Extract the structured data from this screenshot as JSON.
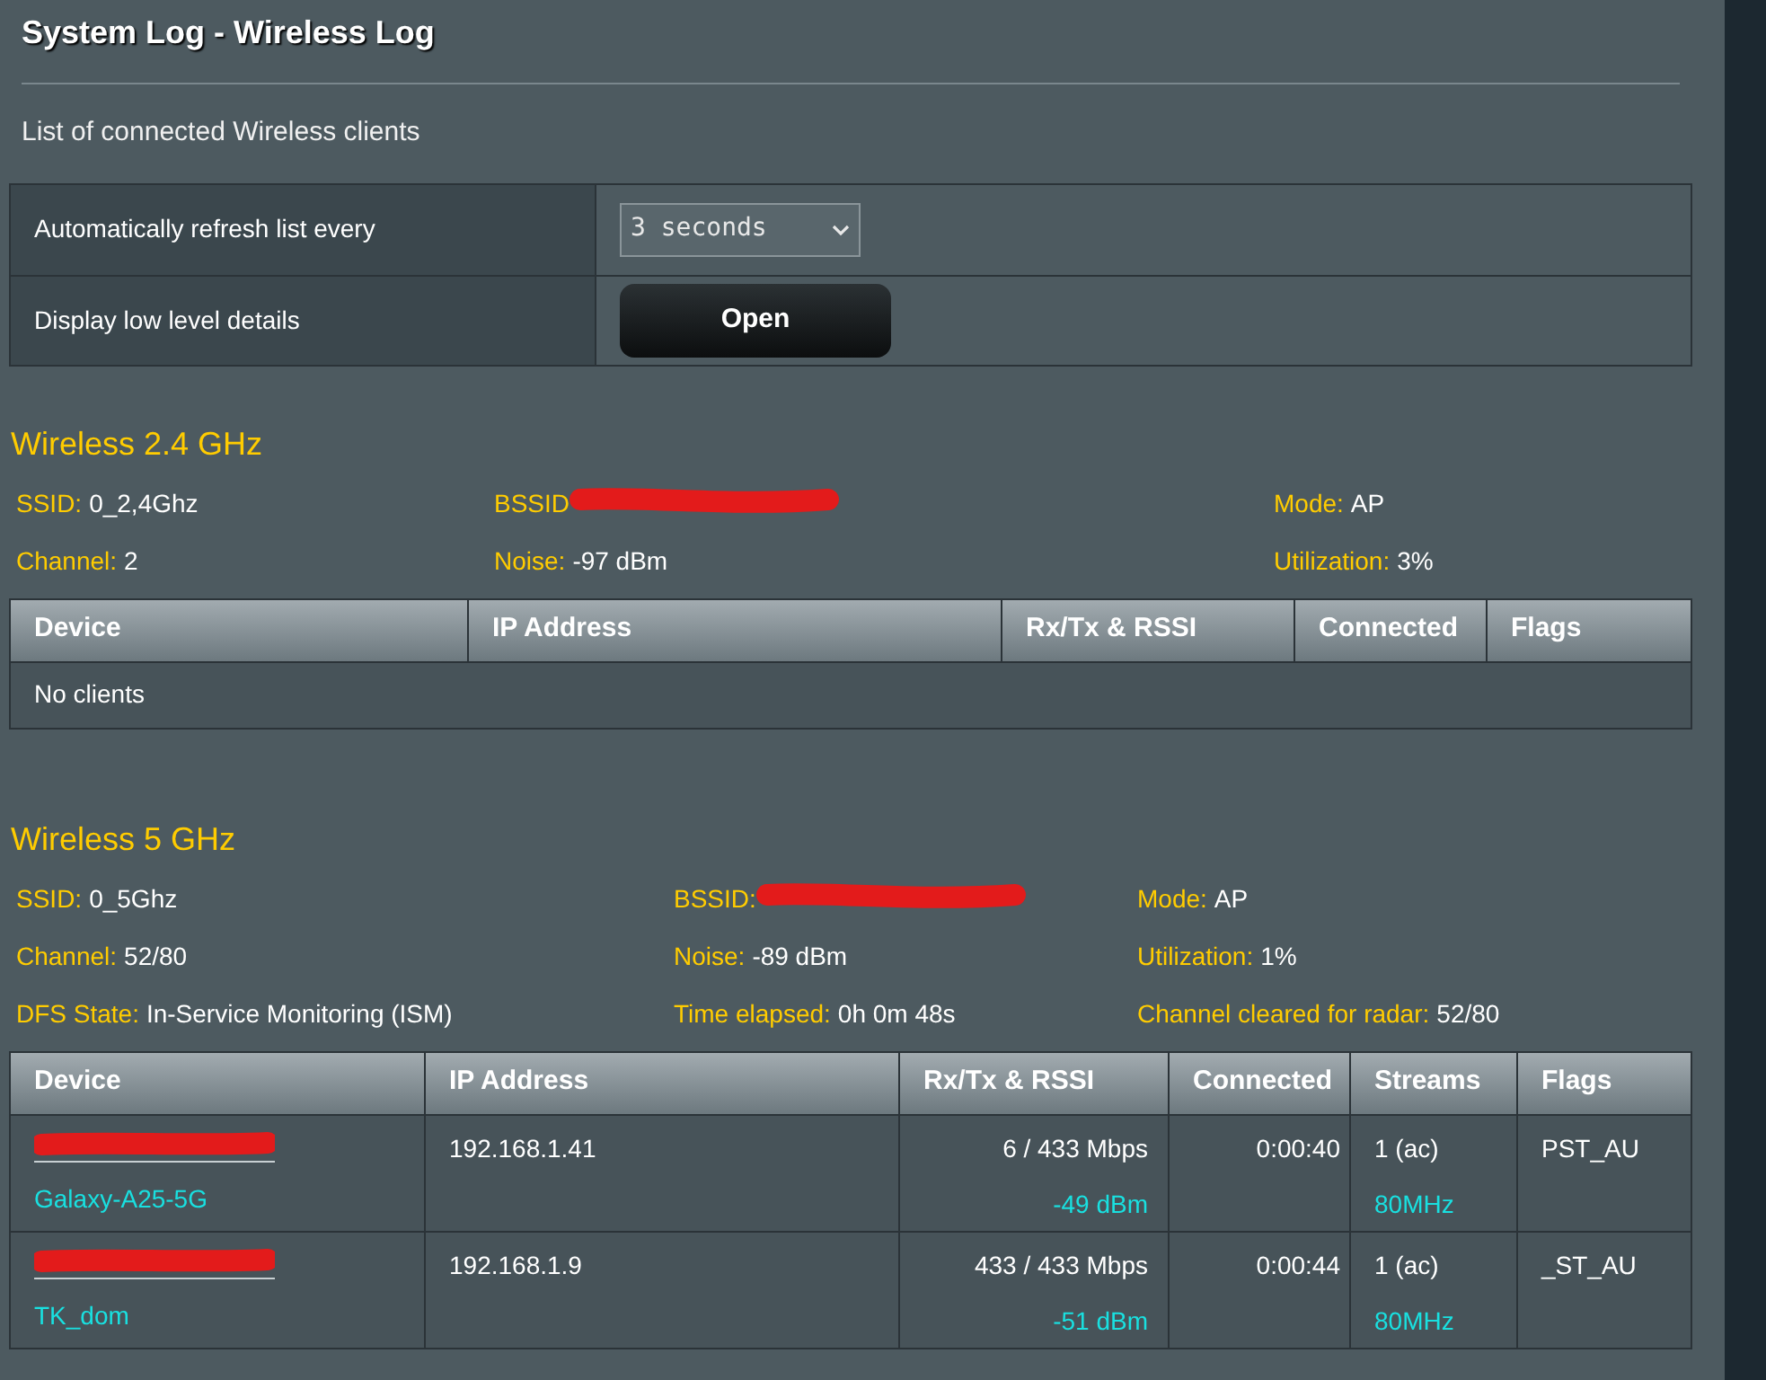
{
  "page": {
    "title": "System Log - Wireless Log",
    "subtitle": "List of connected Wireless clients"
  },
  "settings": [
    {
      "kind": "select",
      "label": "Automatically refresh list every",
      "value": "3 seconds"
    },
    {
      "kind": "button",
      "label": "Display low level details",
      "button": "Open"
    }
  ],
  "bands": [
    {
      "title": "Wireless 2.4 GHz",
      "info": [
        {
          "label": "SSID:",
          "value": "0_2,4Ghz"
        },
        {
          "label": "BSSID",
          "redacted": true
        },
        {
          "label": "Mode:",
          "value": "AP"
        },
        {
          "label": "Channel:",
          "value": "2"
        },
        {
          "label": "Noise:",
          "value": "-97 dBm"
        },
        {
          "label": "Utilization:",
          "value": "3%"
        }
      ],
      "columns": [
        "Device",
        "IP Address",
        "Rx/Tx & RSSI",
        "Connected",
        "Flags"
      ],
      "empty_text": "No clients"
    },
    {
      "title": "Wireless 5 GHz",
      "info": [
        {
          "label": "SSID:",
          "value": "0_5Ghz"
        },
        {
          "label": "BSSID:",
          "redacted": true
        },
        {
          "label": "Mode:",
          "value": "AP"
        },
        {
          "label": "Channel:",
          "value": "52/80"
        },
        {
          "label": "Noise:",
          "value": "-89 dBm"
        },
        {
          "label": "Utilization:",
          "value": "1%"
        },
        {
          "label": "DFS State:",
          "value": "In-Service Monitoring (ISM)"
        },
        {
          "label": "Time elapsed:",
          "value": "0h 0m 48s"
        },
        {
          "label": "Channel cleared for radar:",
          "value": "52/80"
        }
      ],
      "columns": [
        "Device",
        "IP Address",
        "Rx/Tx & RSSI",
        "Connected",
        "Streams",
        "Flags"
      ],
      "clients": [
        {
          "redacted": true,
          "name": "Galaxy-A25-5G",
          "ip": "192.168.1.41",
          "rate": "6 / 433 Mbps",
          "rssi": "-49 dBm",
          "connected": "0:00:40",
          "streams": "1 (ac)",
          "bandwidth": "80MHz",
          "flags": "PST_AU"
        },
        {
          "redacted": true,
          "name": "TK_dom",
          "ip": "192.168.1.9",
          "rate": "433 / 433 Mbps",
          "rssi": "-51 dBm",
          "connected": "0:00:44",
          "streams": "1 (ac)",
          "bandwidth": "80MHz",
          "flags": "_ST_AU"
        }
      ]
    }
  ]
}
